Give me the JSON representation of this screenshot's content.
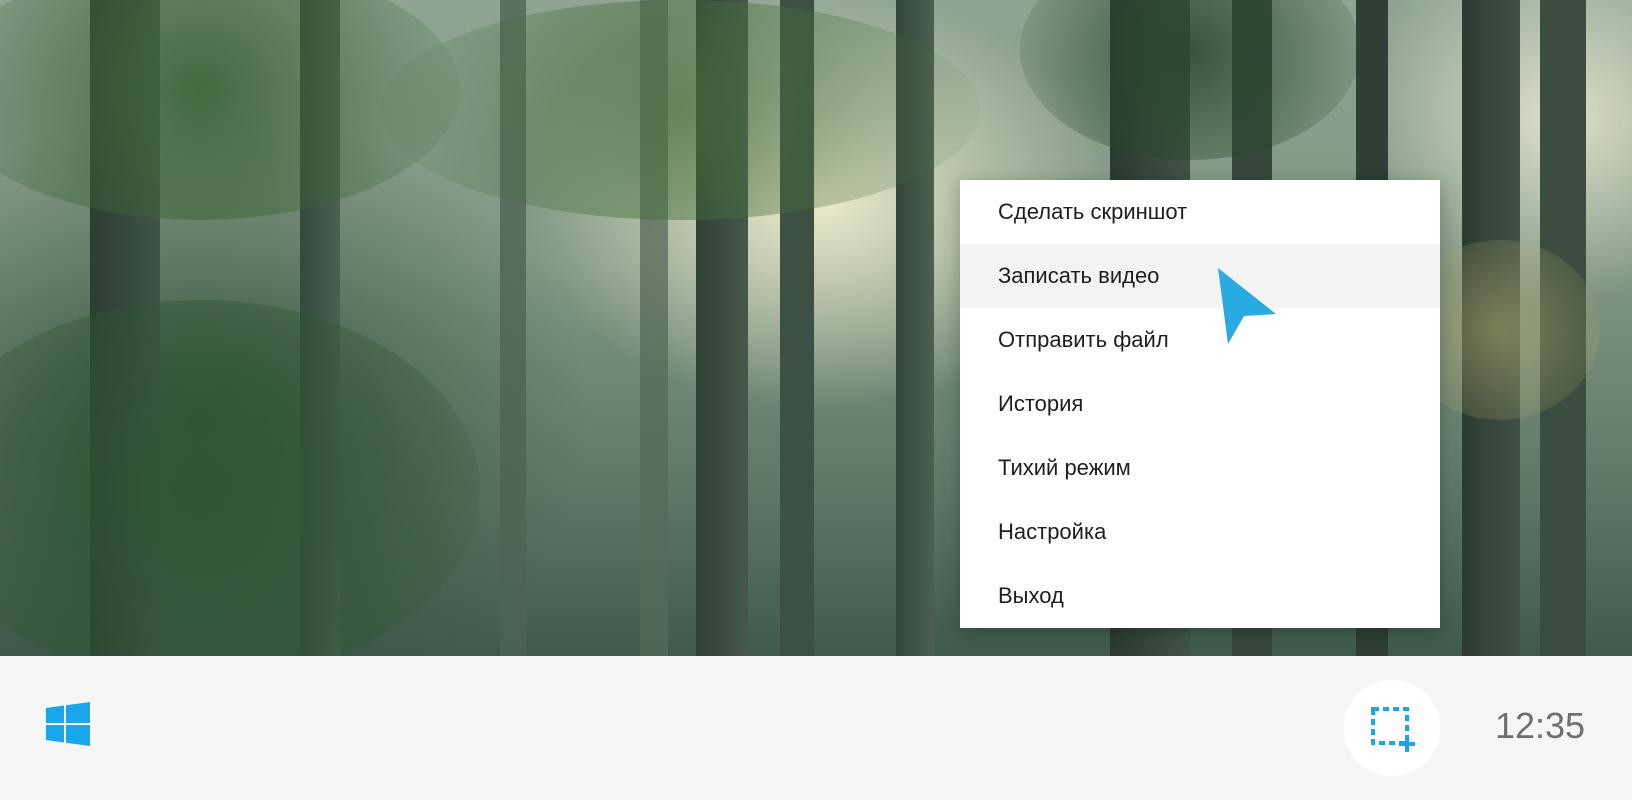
{
  "desktop": {
    "wallpaper": "forest"
  },
  "context_menu": {
    "items": [
      {
        "label": "Сделать скриншот",
        "hover": false
      },
      {
        "label": "Записать видео",
        "hover": true
      },
      {
        "label": "Отправить файл",
        "hover": false
      },
      {
        "label": "История",
        "hover": false
      },
      {
        "label": "Тихий режим",
        "hover": false
      },
      {
        "label": "Настройка",
        "hover": false
      },
      {
        "label": "Выход",
        "hover": false
      }
    ]
  },
  "cursor": {
    "icon": "pointer-arrow-icon",
    "color": "#29abe2"
  },
  "taskbar": {
    "start_icon": "windows-logo-icon",
    "tray_app_icon": "screenshot-selection-icon",
    "accent_color": "#19a6ea",
    "clock": "12:35"
  }
}
